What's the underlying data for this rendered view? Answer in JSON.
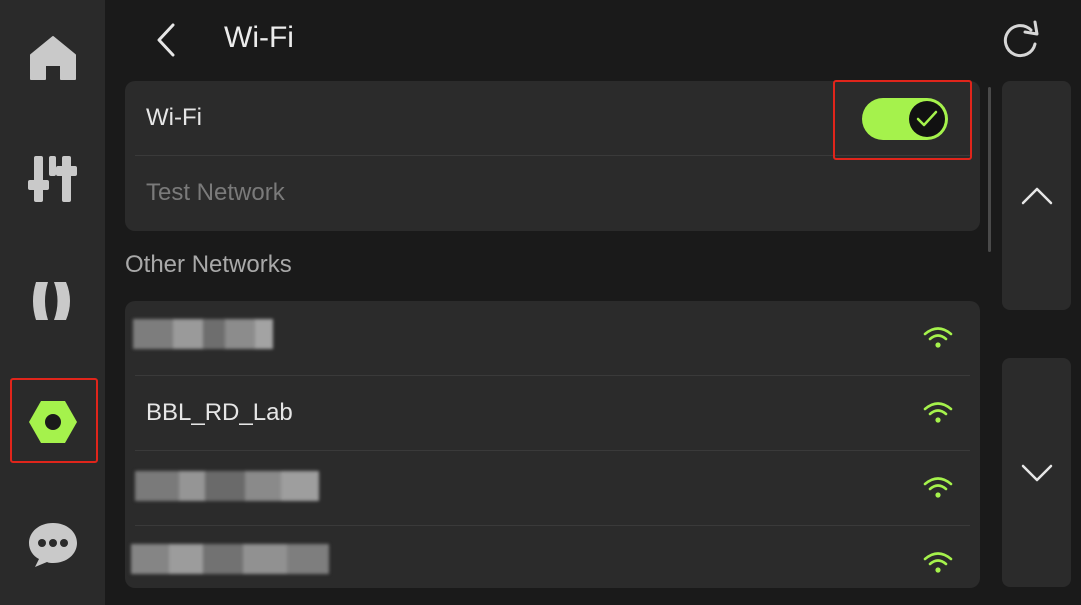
{
  "sidebar": {
    "items": [
      {
        "icon": "home-icon"
      },
      {
        "icon": "sliders-icon"
      },
      {
        "icon": "filament-spool-icon"
      },
      {
        "icon": "settings-hex-nut-icon",
        "active": true
      },
      {
        "icon": "chat-bubble-icon"
      }
    ]
  },
  "header": {
    "back_icon": "chevron-left-icon",
    "title": "Wi-Fi",
    "refresh_icon": "refresh-icon"
  },
  "wifi_card": {
    "toggle_label": "Wi-Fi",
    "toggle_on": true,
    "connected_network": "Test Network"
  },
  "other_networks": {
    "label": "Other Networks",
    "networks": [
      {
        "name": "",
        "obscured": true
      },
      {
        "name": "BBL_RD_Lab",
        "obscured": false
      },
      {
        "name": "",
        "obscured": true
      },
      {
        "name": "",
        "obscured": true
      }
    ]
  },
  "pager": {
    "up_icon": "chevron-up-icon",
    "down_icon": "chevron-down-icon"
  },
  "colors": {
    "accent": "#a5f24c",
    "highlight": "#e0251b",
    "background": "#1a1a1a",
    "card": "#2b2b2b",
    "sidebar": "#2a2a2a"
  }
}
